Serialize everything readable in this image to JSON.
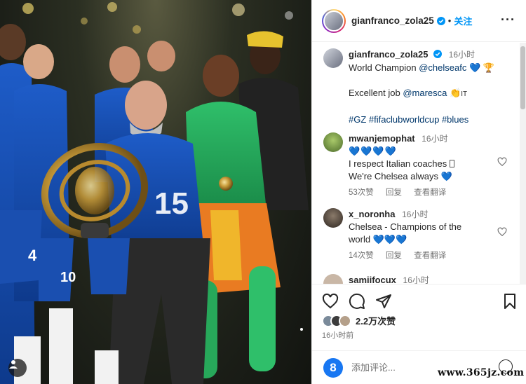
{
  "header": {
    "username": "gianfranco_zola25",
    "follow_label": "关注"
  },
  "caption": {
    "username": "gianfranco_zola25",
    "time": "16小时",
    "line1_text": "World Champion ",
    "line1_mention": "@chelseafc",
    "line2_text": "Excellent job ",
    "line2_mention": "@maresca",
    "line2_suffix": "IT",
    "hashtags": "#GZ #fifaclubworldcup #blues"
  },
  "comments": [
    {
      "username": "mwanjemophat",
      "time": "16小时",
      "line1": "I respect Italian coaches ",
      "line2": "We're Chelsea always",
      "likes": "53次赞",
      "reply": "回复",
      "translate": "查看翻译"
    },
    {
      "username": "x_noronha",
      "time": "16小时",
      "line1": "Chelsea - Champions of the",
      "line2": "world",
      "likes": "14次赞",
      "reply": "回复",
      "translate": "查看翻译"
    },
    {
      "username": "samiifocux",
      "time": "16小时"
    }
  ],
  "actions": {
    "likes": "2.2万次赞",
    "posted": "16小时前"
  },
  "comment_box": {
    "placeholder": "添加评论...",
    "emoji_letter": "8"
  },
  "watermark": "www.365jz.com",
  "colors": {
    "link": "#00376b",
    "follow": "#0095f6",
    "heart_emoji": "#1f78d8",
    "verified": "#0095f6"
  },
  "icons": [
    "verified-badge-icon",
    "more-options-icon",
    "heart-icon",
    "comment-icon",
    "share-icon",
    "bookmark-icon",
    "smiley-icon",
    "user-icon"
  ]
}
